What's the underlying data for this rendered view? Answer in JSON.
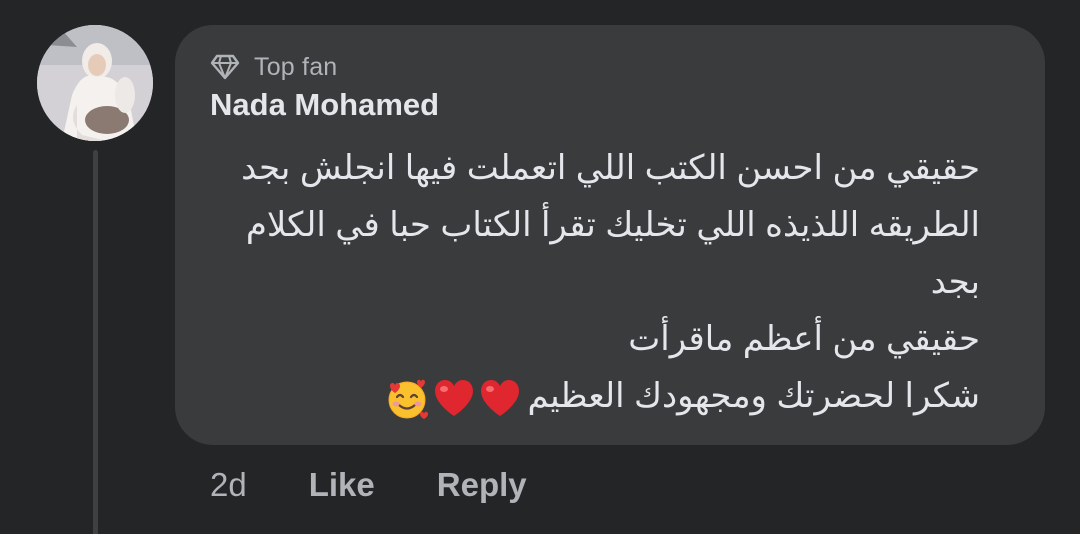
{
  "comment": {
    "badge": {
      "icon": "diamond-icon",
      "label": "Top fan"
    },
    "author": "Nada Mohamed",
    "lines": [
      "حقيقي من احسن الكتب اللي اتعملت فيها انجلش بجد",
      "الطريقه اللذيذه اللي تخليك تقرأ الكتاب حبا في الكلام",
      "بجد",
      "حقيقي من أعظم ماقرأت",
      "شكرا لحضرتك ومجهودك العظيم"
    ],
    "emojis": [
      "red-heart-icon",
      "red-heart-icon",
      "smiling-face-with-hearts-icon"
    ]
  },
  "actions": {
    "time": "2d",
    "like_label": "Like",
    "reply_label": "Reply"
  },
  "colors": {
    "background": "#242526",
    "bubble": "#3a3b3c",
    "primary_text": "#e4e6eb",
    "secondary_text": "#b0b3b8",
    "thread_line": "#3e4042"
  }
}
